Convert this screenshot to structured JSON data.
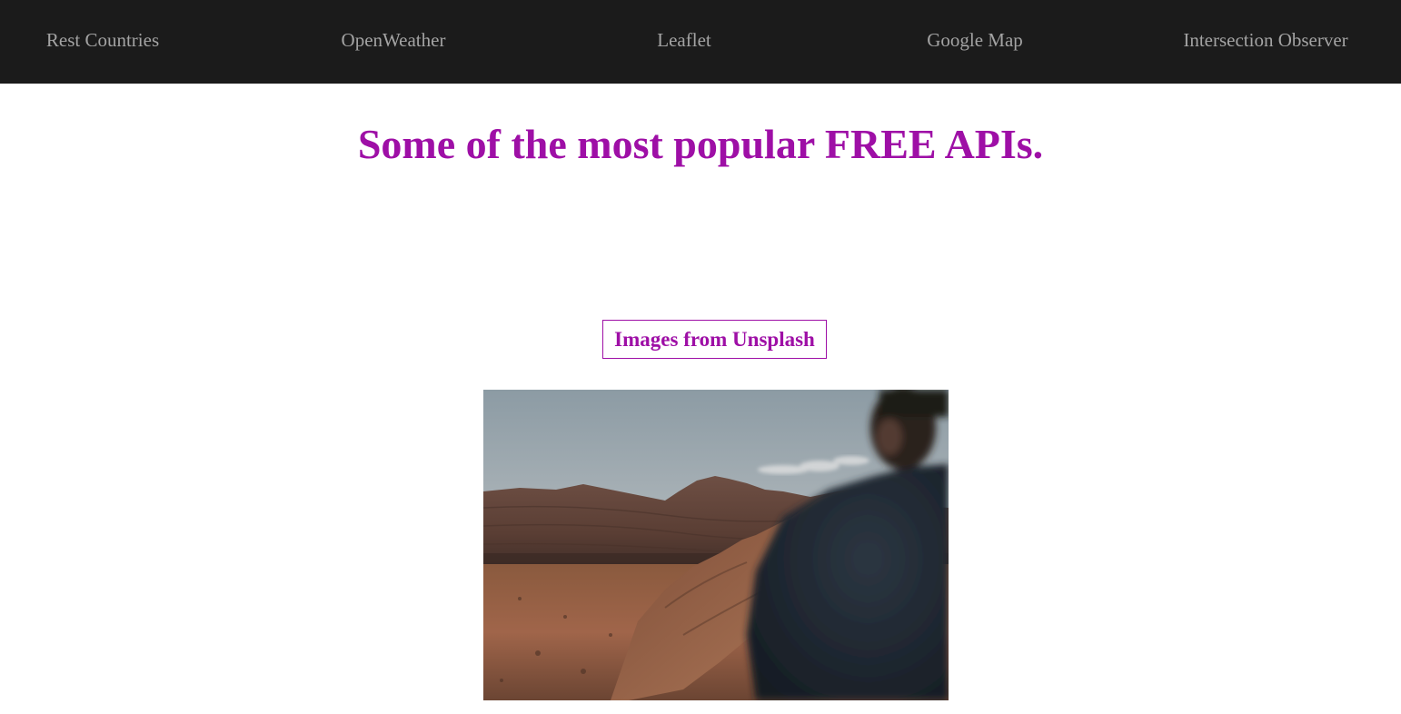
{
  "nav": {
    "items": [
      {
        "label": "Rest Countries"
      },
      {
        "label": "OpenWeather"
      },
      {
        "label": "Leaflet"
      },
      {
        "label": "Google Map"
      },
      {
        "label": "Intersection Observer"
      }
    ]
  },
  "main": {
    "headline": "Some of the most popular FREE APIs.",
    "section_label": "Images from Unsplash",
    "photo_icon": "desert-landscape-photo"
  },
  "colors": {
    "navbar_bg": "#1b1b1b",
    "nav_text": "#a3a3a3",
    "accent": "#9e0fa6",
    "page_bg": "#ffffff"
  }
}
